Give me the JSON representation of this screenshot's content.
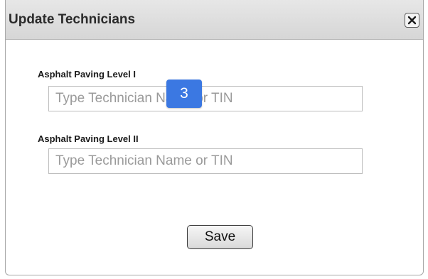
{
  "dialog": {
    "title": "Update Technicians",
    "close_icon": "close-icon"
  },
  "fields": [
    {
      "label": "Asphalt Paving Level I",
      "placeholder": "Type Technician Name or TIN",
      "value": ""
    },
    {
      "label": "Asphalt Paving Level II",
      "placeholder": "Type Technician Name or TIN",
      "value": ""
    }
  ],
  "badge": {
    "text": "3"
  },
  "actions": {
    "save_label": "Save"
  },
  "colors": {
    "badge": "#3b78e2",
    "titlebar": "#dcdcdc"
  }
}
